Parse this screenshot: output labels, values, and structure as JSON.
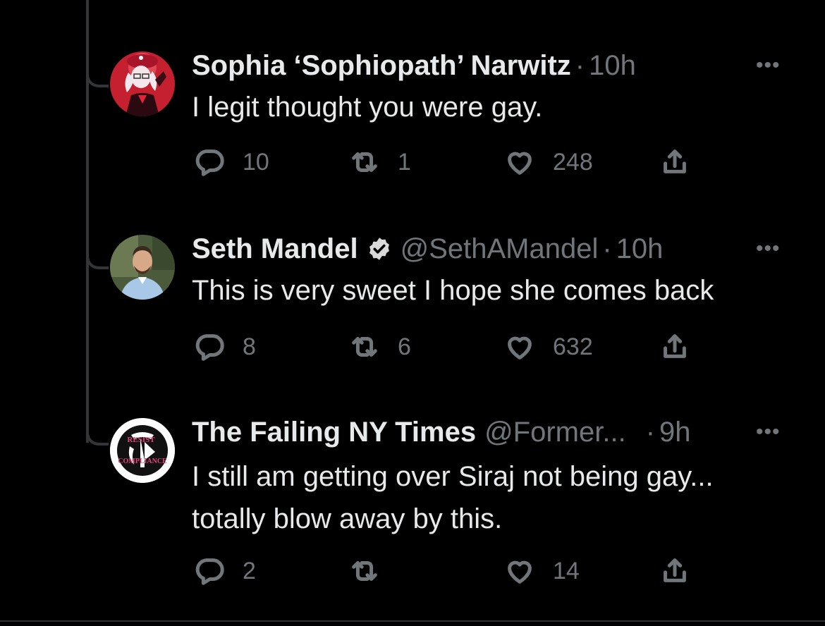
{
  "tweets": [
    {
      "name": "Sophia ‘Sophiopath’ Narwitz",
      "handle": "",
      "dot": "·",
      "time": "10h",
      "more": "•••",
      "text": "I legit thought you were gay.",
      "replies": "10",
      "retweets": "1",
      "likes": "248",
      "verified": false,
      "avatar": "anime-character-avatar"
    },
    {
      "name": "Seth Mandel",
      "handle": "@SethAMandel",
      "dot": "·",
      "time": "10h",
      "more": "•••",
      "text": "This is very sweet I hope she comes back",
      "replies": "8",
      "retweets": "6",
      "likes": "632",
      "verified": true,
      "avatar": "man-photo-avatar"
    },
    {
      "name": "The Failing NY Times",
      "handle": "@Former...",
      "dot": "·",
      "time": "9h",
      "more": "•••",
      "text": "I still am getting over Siraj not being gay... totally blow away by this.",
      "replies": "2",
      "retweets": "",
      "likes": "14",
      "verified": false,
      "avatar": "resist-compliance-logo-avatar",
      "avatar_text_top": "RESIST",
      "avatar_text_bottom": "COMPLIANCE"
    }
  ],
  "colors": {
    "background": "#000000",
    "text_primary": "#e7e9ea",
    "text_secondary": "#71767b",
    "thread_line": "#333639"
  },
  "icons": [
    "reply-icon",
    "retweet-icon",
    "like-icon",
    "share-icon",
    "verified-badge-icon",
    "more-icon"
  ]
}
